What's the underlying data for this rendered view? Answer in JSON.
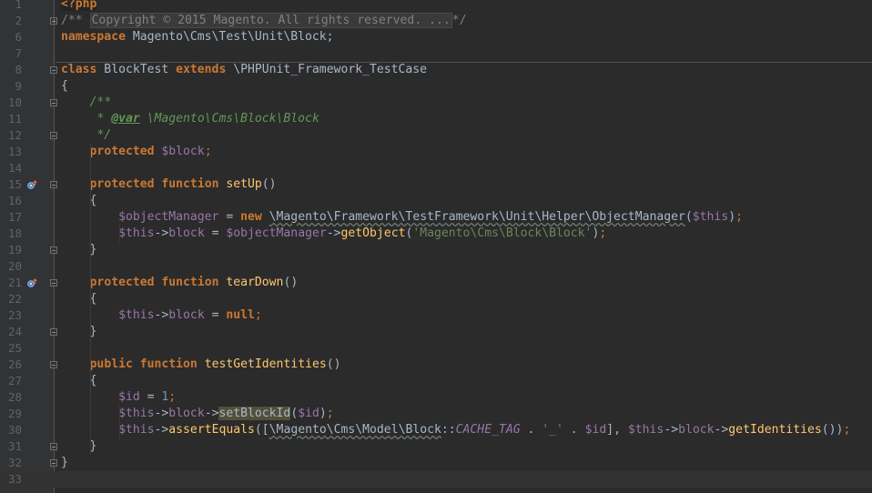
{
  "editor": {
    "colors": {
      "background": "#2b2b2b",
      "gutter": "#313335",
      "keyword": "#cc7832",
      "variable": "#9876aa",
      "function": "#ffc66d",
      "string": "#6a8759",
      "number": "#6897bb",
      "comment": "#808080",
      "doc": "#629755"
    },
    "override_icon": "override-method-icon",
    "lines": [
      {
        "n": "1",
        "tokens": [
          [
            "phptag",
            "<?php"
          ]
        ]
      },
      {
        "n": "2",
        "tokens": [
          [
            "cmt",
            "/** "
          ],
          [
            "folded",
            "Copyright © 2015 Magento. All rights reserved. ..."
          ],
          [
            "cmt",
            "*/"
          ]
        ]
      },
      {
        "n": "6",
        "tokens": [
          [
            "kw",
            "namespace"
          ],
          [
            "plain",
            " Magento\\Cms\\Test\\Unit\\Block;"
          ]
        ]
      },
      {
        "n": "7",
        "tokens": []
      },
      {
        "n": "8",
        "tokens": [
          [
            "kw",
            "class"
          ],
          [
            "plain",
            " BlockTest "
          ],
          [
            "kw",
            "extends"
          ],
          [
            "plain",
            " \\PHPUnit_Framework_TestCase"
          ]
        ]
      },
      {
        "n": "9",
        "tokens": [
          [
            "plain",
            "{"
          ]
        ]
      },
      {
        "n": "10",
        "tokens": [
          [
            "plain",
            "    "
          ],
          [
            "doc",
            "/**"
          ]
        ]
      },
      {
        "n": "11",
        "tokens": [
          [
            "plain",
            "     "
          ],
          [
            "doc",
            "* "
          ],
          [
            "doctag",
            "@var"
          ],
          [
            "doc",
            " \\Magento\\Cms\\Block\\Block"
          ]
        ]
      },
      {
        "n": "12",
        "tokens": [
          [
            "plain",
            "     "
          ],
          [
            "doc",
            "*/"
          ]
        ]
      },
      {
        "n": "13",
        "tokens": [
          [
            "plain",
            "    "
          ],
          [
            "kw",
            "protected"
          ],
          [
            "plain",
            " "
          ],
          [
            "var",
            "$block"
          ],
          [
            "kwn",
            ";"
          ]
        ]
      },
      {
        "n": "14",
        "tokens": []
      },
      {
        "n": "15",
        "tokens": [
          [
            "plain",
            "    "
          ],
          [
            "kw",
            "protected"
          ],
          [
            "plain",
            " "
          ],
          [
            "kw",
            "function"
          ],
          [
            "plain",
            " "
          ],
          [
            "fn",
            "setUp"
          ],
          [
            "plain",
            "()"
          ]
        ]
      },
      {
        "n": "16",
        "tokens": [
          [
            "plain",
            "    {"
          ]
        ]
      },
      {
        "n": "17",
        "tokens": [
          [
            "plain",
            "        "
          ],
          [
            "var",
            "$objectManager"
          ],
          [
            "plain",
            " = "
          ],
          [
            "kw",
            "new"
          ],
          [
            "plain",
            " "
          ],
          [
            "squiggle",
            "\\Magento\\Framework\\TestFramework\\Unit\\Helper\\ObjectManager"
          ],
          [
            "plain",
            "("
          ],
          [
            "var",
            "$this"
          ],
          [
            "plain",
            ")"
          ],
          [
            "kwn",
            ";"
          ]
        ]
      },
      {
        "n": "18",
        "tokens": [
          [
            "plain",
            "        "
          ],
          [
            "var",
            "$this"
          ],
          [
            "plain",
            "->"
          ],
          [
            "var",
            "block"
          ],
          [
            "plain",
            " = "
          ],
          [
            "var",
            "$objectManager"
          ],
          [
            "plain",
            "->"
          ],
          [
            "fn",
            "getObject"
          ],
          [
            "plain",
            "("
          ],
          [
            "str",
            "'Magento\\Cms\\Block\\Block'"
          ],
          [
            "plain",
            ")"
          ],
          [
            "kwn",
            ";"
          ]
        ]
      },
      {
        "n": "19",
        "tokens": [
          [
            "plain",
            "    }"
          ]
        ]
      },
      {
        "n": "20",
        "tokens": []
      },
      {
        "n": "21",
        "tokens": [
          [
            "plain",
            "    "
          ],
          [
            "kw",
            "protected"
          ],
          [
            "plain",
            " "
          ],
          [
            "kw",
            "function"
          ],
          [
            "plain",
            " "
          ],
          [
            "fn",
            "tearDown"
          ],
          [
            "plain",
            "()"
          ]
        ]
      },
      {
        "n": "22",
        "tokens": [
          [
            "plain",
            "    {"
          ]
        ]
      },
      {
        "n": "23",
        "tokens": [
          [
            "plain",
            "        "
          ],
          [
            "var",
            "$this"
          ],
          [
            "plain",
            "->"
          ],
          [
            "var",
            "block"
          ],
          [
            "plain",
            " = "
          ],
          [
            "kw",
            "null"
          ],
          [
            "kwn",
            ";"
          ]
        ]
      },
      {
        "n": "24",
        "tokens": [
          [
            "plain",
            "    }"
          ]
        ]
      },
      {
        "n": "25",
        "tokens": []
      },
      {
        "n": "26",
        "tokens": [
          [
            "plain",
            "    "
          ],
          [
            "kw",
            "public"
          ],
          [
            "plain",
            " "
          ],
          [
            "kw",
            "function"
          ],
          [
            "plain",
            " "
          ],
          [
            "fn",
            "testGetIdentities"
          ],
          [
            "plain",
            "()"
          ]
        ]
      },
      {
        "n": "27",
        "tokens": [
          [
            "plain",
            "    {"
          ]
        ]
      },
      {
        "n": "28",
        "tokens": [
          [
            "plain",
            "        "
          ],
          [
            "var",
            "$id"
          ],
          [
            "plain",
            " = "
          ],
          [
            "num",
            "1"
          ],
          [
            "kwn",
            ";"
          ]
        ]
      },
      {
        "n": "29",
        "tokens": [
          [
            "plain",
            "        "
          ],
          [
            "var",
            "$this"
          ],
          [
            "plain",
            "->"
          ],
          [
            "var",
            "block"
          ],
          [
            "plain",
            "->"
          ],
          [
            "highlight",
            "setBlockId"
          ],
          [
            "plain",
            "("
          ],
          [
            "var",
            "$id"
          ],
          [
            "plain",
            ")"
          ],
          [
            "kwn",
            ";"
          ]
        ]
      },
      {
        "n": "30",
        "tokens": [
          [
            "plain",
            "        "
          ],
          [
            "var",
            "$this"
          ],
          [
            "plain",
            "->"
          ],
          [
            "fn",
            "assertEquals"
          ],
          [
            "plain",
            "(["
          ],
          [
            "squiggle",
            "\\Magento\\Cms\\Model\\Block"
          ],
          [
            "plain",
            "::"
          ],
          [
            "const",
            "CACHE_TAG"
          ],
          [
            "plain",
            " . "
          ],
          [
            "str",
            "'_'"
          ],
          [
            "plain",
            " . "
          ],
          [
            "var",
            "$id"
          ],
          [
            "plain",
            "], "
          ],
          [
            "var",
            "$this"
          ],
          [
            "plain",
            "->"
          ],
          [
            "var",
            "block"
          ],
          [
            "plain",
            "->"
          ],
          [
            "fn",
            "getIdentities"
          ],
          [
            "plain",
            "())"
          ],
          [
            "kwn",
            ";"
          ]
        ]
      },
      {
        "n": "31",
        "tokens": [
          [
            "plain",
            "    }"
          ]
        ]
      },
      {
        "n": "32",
        "tokens": [
          [
            "plain",
            "}"
          ]
        ]
      },
      {
        "n": "33",
        "tokens": []
      }
    ]
  }
}
